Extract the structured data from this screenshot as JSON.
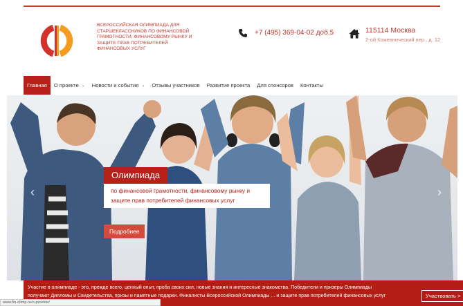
{
  "header": {
    "org_name": "Всероссийская олимпиада для старшеклассников по финансовой грамотности, финансовому рынку и защите прав потребителей финансовых услуг",
    "phone": "+7 (495) 369-04-02 доб.5",
    "city": "115114 Москва",
    "street": "2-ой Кожевнический пер., д. 12"
  },
  "nav": {
    "items": [
      {
        "label": "Главная"
      },
      {
        "label": "О проекте"
      },
      {
        "label": "Новости и события"
      },
      {
        "label": "Отзывы участников"
      },
      {
        "label": "Развитие проекта"
      },
      {
        "label": "Для спонсоров"
      },
      {
        "label": "Контакты"
      }
    ]
  },
  "hero": {
    "title": "Олимпиада",
    "text": "по финансовой грамотности, финансовому рынку и защите прав потребителей финансовых услуг",
    "button": "Подробнее",
    "arrow_left": "‹",
    "arrow_right": "›"
  },
  "banner": {
    "text": "Участие в олимпиаде - это, прежде всего, ценный опыт, проба своих сил, новые знания и интересные знакомства. Победители и призеры Олимпиады получают Дипломы и Свидетельства, призы и памятные подарки. Финалисты Всероссийской Олимпиады ... и защите прав потребителей финансовых услуг получают возможность",
    "button": "Участвовать >"
  },
  "status": {
    "url": "www.fin-olimp.ru/o-proekte/"
  },
  "colors": {
    "accent": "#b82117",
    "logo_orange": "#f39c1f",
    "logo_red": "#d3322a"
  }
}
